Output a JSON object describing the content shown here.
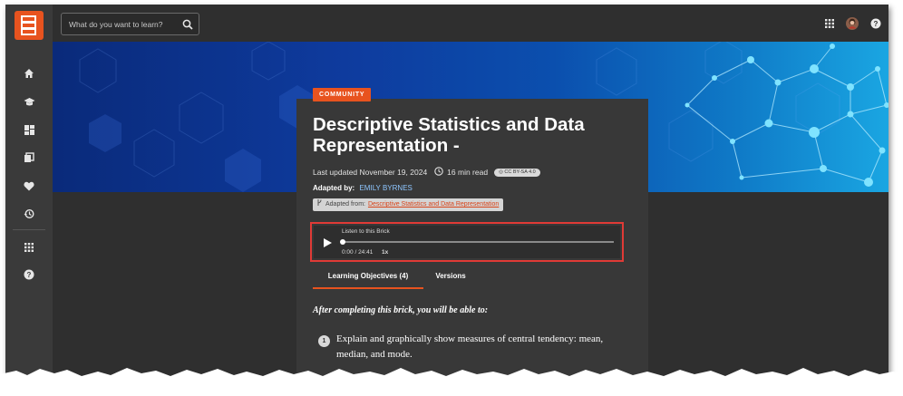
{
  "search": {
    "placeholder": "What do you want to learn?"
  },
  "sidebar": {
    "items": [
      {
        "icon": "home-icon"
      },
      {
        "icon": "graduation-cap-icon"
      },
      {
        "icon": "dashboard-icon"
      },
      {
        "icon": "library-icon"
      },
      {
        "icon": "heart-icon"
      },
      {
        "icon": "history-icon"
      },
      {
        "icon": "apps-grid-icon"
      },
      {
        "icon": "help-icon"
      }
    ]
  },
  "topbar": {
    "icons": [
      "apps-grid-icon",
      "avatar",
      "help-icon"
    ]
  },
  "article": {
    "badge": "COMMUNITY",
    "title": "Descriptive Statistics and Data Representation -",
    "last_updated": "Last updated November 19, 2024",
    "read_time": "16 min read",
    "license": "CC BY-SA 4.0",
    "adapted_by_label": "Adapted by:",
    "adapted_by_name": "EMILY BYRNES",
    "adapted_from_label": "Adapted from:",
    "adapted_from_link": "Descriptive Statistics and Data Representation"
  },
  "player": {
    "label": "Listen to this Brick",
    "time": "0:00 / 24:41",
    "speed": "1x",
    "progress": 0.0
  },
  "tabs": [
    {
      "label": "Learning Objectives (4)",
      "active": true
    },
    {
      "label": "Versions",
      "active": false
    }
  ],
  "objectives": {
    "intro": "After completing this brick, you will be able to:",
    "items": [
      {
        "number": "1",
        "text": "Explain and graphically show measures of central tendency: mean, median, and mode."
      }
    ]
  },
  "colors": {
    "accent": "#e8531f",
    "highlight": "#e03a36",
    "link": "#8ec6ff"
  }
}
